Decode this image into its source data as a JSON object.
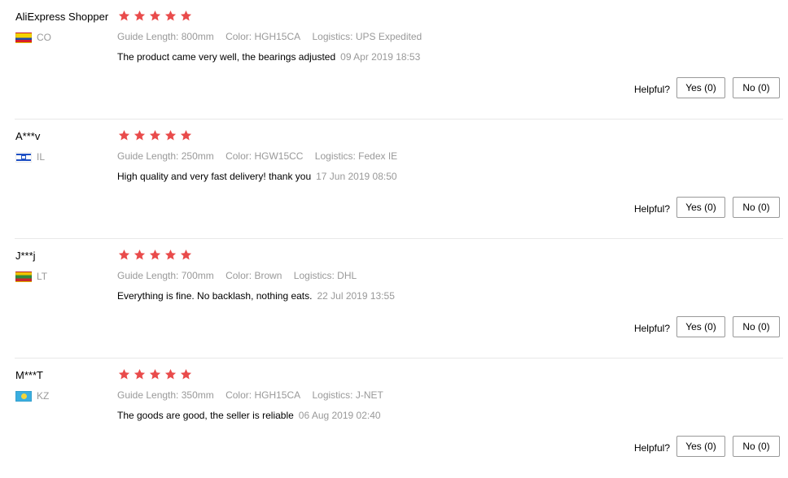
{
  "reviews": [
    {
      "user": "AliExpress Shopper",
      "country": "CO",
      "flag": "colombia-flag",
      "rating": 5,
      "guide_length": "Guide Length: 800mm",
      "color": "Color: HGH15CA",
      "logistics": "Logistics: UPS Expedited",
      "comment": "The product came very well, the bearings adjusted",
      "date": "09 Apr 2019 18:53",
      "helpful_label": "Helpful?",
      "yes_label": "Yes (0)",
      "no_label": "No (0)"
    },
    {
      "user": "A***v",
      "country": "IL",
      "flag": "israel-flag",
      "rating": 5,
      "guide_length": "Guide Length: 250mm",
      "color": "Color: HGW15CC",
      "logistics": "Logistics: Fedex IE",
      "comment": "High quality and very fast delivery! thank you",
      "date": "17 Jun 2019 08:50",
      "helpful_label": "Helpful?",
      "yes_label": "Yes (0)",
      "no_label": "No (0)"
    },
    {
      "user": "J***j",
      "country": "LT",
      "flag": "lithuania-flag",
      "rating": 5,
      "guide_length": "Guide Length: 700mm",
      "color": "Color: Brown",
      "logistics": "Logistics: DHL",
      "comment": "Everything is fine. No backlash, nothing eats.",
      "date": "22 Jul 2019 13:55",
      "helpful_label": "Helpful?",
      "yes_label": "Yes (0)",
      "no_label": "No (0)"
    },
    {
      "user": "M***T",
      "country": "KZ",
      "flag": "kazakhstan-flag",
      "rating": 5,
      "guide_length": "Guide Length: 350mm",
      "color": "Color: HGH15CA",
      "logistics": "Logistics: J-NET",
      "comment": "The goods are good, the seller is reliable",
      "date": "06 Aug 2019 02:40",
      "helpful_label": "Helpful?",
      "yes_label": "Yes (0)",
      "no_label": "No (0)"
    }
  ],
  "colors": {
    "star": "#e94b4b",
    "muted_text": "#999999",
    "button_border": "#999999"
  }
}
